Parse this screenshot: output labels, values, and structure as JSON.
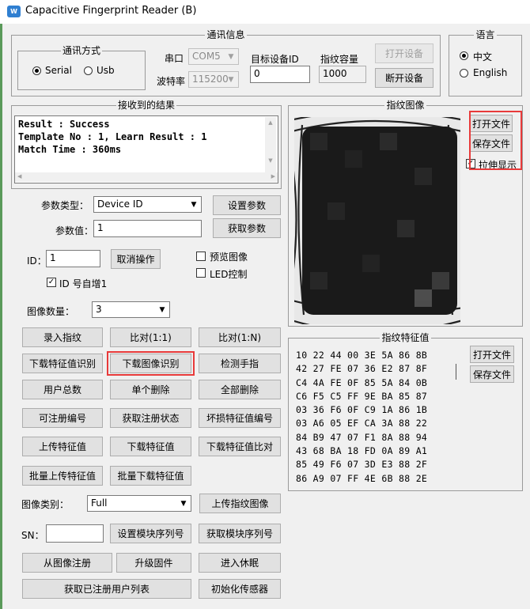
{
  "window": {
    "title": "Capacitive Fingerprint Reader (B)",
    "icon": "app-logo-icon"
  },
  "comm": {
    "group_title": "通讯信息",
    "method_title": "通讯方式",
    "serial_label": "Serial",
    "usb_label": "Usb",
    "selected": "Serial",
    "port_label": "串口",
    "port_value": "COM5",
    "baud_label": "波特率",
    "baud_value": "115200",
    "target_id_label": "目标设备ID",
    "target_id_value": "0",
    "capacity_label": "指纹容量",
    "capacity_value": "1000",
    "open_device_label": "打开设备",
    "close_device_label": "断开设备"
  },
  "language": {
    "group_title": "语言",
    "chinese_label": "中文",
    "english_label": "English",
    "selected": "中文"
  },
  "result": {
    "group_title": "接收到的结果",
    "lines": "Result : Success\nTemplate No : 1, Learn Result : 1\nMatch Time : 360ms"
  },
  "fingerprint_image": {
    "group_title": "指纹图像",
    "open_file_label": "打开文件",
    "save_file_label": "保存文件",
    "stretch_label": "拉伸显示",
    "stretch_checked": true
  },
  "features": {
    "group_title": "指纹特征值",
    "open_file_label": "打开文件",
    "save_file_label": "保存文件",
    "hex": "10 22 44 00 3E 5A 86 8B\n42 27 FE 07 36 E2 87 8F\nC4 4A FE 0F 85 5A 84 0B\nC6 F5 C5 FF 9E BA 85 87\n03 36 F6 0F C9 1A 86 1B\n03 A6 05 EF CA 3A 88 22\n84 B9 47 07 F1 8A 88 94\n43 68 BA 18 FD 0A 89 A1\n85 49 F6 07 3D E3 88 2F\n86 A9 07 FF 4E 6B 88 2E"
  },
  "params": {
    "type_label": "参数类型：",
    "type_value": "Device ID",
    "set_label": "设置参数",
    "value_label": "参数值：",
    "value": "1",
    "get_label": "获取参数"
  },
  "id_row": {
    "id_label": "ID：",
    "id_value": "1",
    "cancel_label": "取消操作",
    "preview_label": "预览图像",
    "preview_checked": false,
    "led_label": "LED控制",
    "led_checked": false,
    "autoinc_label": "ID 号自增1",
    "autoinc_checked": true
  },
  "image_count": {
    "label": "图像数量：",
    "value": "3"
  },
  "buttons": {
    "enroll": "录入指纹",
    "match11": "比对(1:1)",
    "match1n": "比对(1:N)",
    "download_feature_identify": "下载特征值识别",
    "download_image_identify": "下载图像识别",
    "detect_finger": "检测手指",
    "user_total": "用户总数",
    "delete_single": "单个删除",
    "delete_all": "全部删除",
    "enrollable_no": "可注册编号",
    "get_enroll_status": "获取注册状态",
    "damaged_feature_no": "坏损特征值编号",
    "upload_feature": "上传特征值",
    "download_feature": "下载特征值",
    "download_feature_compare": "下载特征值比对",
    "batch_upload_feature": "批量上传特征值",
    "batch_download_feature": "批量下载特征值",
    "upload_fp_image": "上传指纹图像",
    "set_module_sn": "设置模块序列号",
    "get_module_sn": "获取模块序列号",
    "enroll_from_image": "从图像注册",
    "upgrade_firmware": "升级固件",
    "enter_sleep": "进入休眠",
    "get_enrolled_list": "获取已注册用户列表",
    "init_sensor": "初始化传感器"
  },
  "image_category": {
    "label": "图像类别：",
    "value": "Full"
  },
  "sn": {
    "label": "SN：",
    "value": ""
  },
  "colors": {
    "highlight": "#e83a3a",
    "button_face": "#e1e1e1"
  }
}
